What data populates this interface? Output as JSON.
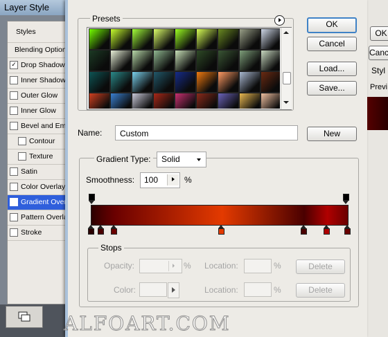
{
  "background_window": {
    "title": "Layer Style",
    "styles_header": "Styles",
    "items": [
      {
        "label": "Blending Options",
        "checkbox": false,
        "checked": false,
        "indent": false,
        "selected": false
      },
      {
        "label": "Drop Shadow",
        "checkbox": true,
        "checked": true,
        "indent": false,
        "selected": false
      },
      {
        "label": "Inner Shadow",
        "checkbox": true,
        "checked": false,
        "indent": false,
        "selected": false
      },
      {
        "label": "Outer Glow",
        "checkbox": true,
        "checked": false,
        "indent": false,
        "selected": false
      },
      {
        "label": "Inner Glow",
        "checkbox": true,
        "checked": false,
        "indent": false,
        "selected": false
      },
      {
        "label": "Bevel and Emboss",
        "checkbox": true,
        "checked": false,
        "indent": false,
        "selected": false
      },
      {
        "label": "Contour",
        "checkbox": true,
        "checked": false,
        "indent": true,
        "selected": false
      },
      {
        "label": "Texture",
        "checkbox": true,
        "checked": false,
        "indent": true,
        "selected": false
      },
      {
        "label": "Satin",
        "checkbox": true,
        "checked": false,
        "indent": false,
        "selected": false
      },
      {
        "label": "Color Overlay",
        "checkbox": true,
        "checked": false,
        "indent": false,
        "selected": false
      },
      {
        "label": "Gradient Overlay",
        "checkbox": true,
        "checked": true,
        "indent": false,
        "selected": true
      },
      {
        "label": "Pattern Overlay",
        "checkbox": true,
        "checked": false,
        "indent": false,
        "selected": false
      },
      {
        "label": "Stroke",
        "checkbox": true,
        "checked": false,
        "indent": false,
        "selected": false
      }
    ],
    "right_partial": [
      "OK",
      "Cance",
      "Styl",
      "Previ"
    ]
  },
  "gradient_editor": {
    "presets_label": "Presets",
    "buttons": {
      "ok": "OK",
      "cancel": "Cancel",
      "load": "Load...",
      "save": "Save...",
      "new": "New"
    },
    "name_label": "Name:",
    "name_value": "Custom",
    "gradient_type_label": "Gradient Type:",
    "gradient_type_value": "Solid",
    "smoothness_label": "Smoothness:",
    "smoothness_value": "100",
    "smoothness_unit": "%",
    "stops_label": "Stops",
    "opacity_label": "Opacity:",
    "color_label": "Color:",
    "location_label": "Location:",
    "percent": "%",
    "delete_label": "Delete",
    "presets": [
      [
        "#74ff00",
        "#c8ff2e",
        "#a4ff3a",
        "#dcff6a",
        "#9cff22",
        "#d8ff56",
        "#6a8a22",
        "#9aa088",
        "#cfd8e8"
      ],
      [
        "#1c3a24",
        "#e8f0d8",
        "#b8d8a8",
        "#90b890",
        "#c8e0b8",
        "#2e4a26",
        "#3a5634",
        "#7e9e7a",
        "#c8d8c0"
      ],
      [
        "#0e5454",
        "#2a8a8a",
        "#7ad0ec",
        "#22586a",
        "#162c8a",
        "#f07a10",
        "#ff9a62",
        "#a8b8d0",
        "#6a2a12"
      ],
      [
        "#d04020",
        "#3a80d0",
        "#c8c8d8",
        "#a82818",
        "#c83070",
        "#8a2a1a",
        "#6a62b8",
        "#e8b850",
        "#f0c0a0"
      ]
    ],
    "gradient_stops_colors": [
      "#2b0000",
      "#4a0000",
      "#6a0000",
      "#e33a00",
      "#4a0000",
      "#b00000",
      "#6a0000"
    ],
    "gradient_stop_locations": [
      0,
      4,
      9,
      51,
      83,
      92,
      100
    ]
  },
  "watermark": "ALFOART.COM"
}
